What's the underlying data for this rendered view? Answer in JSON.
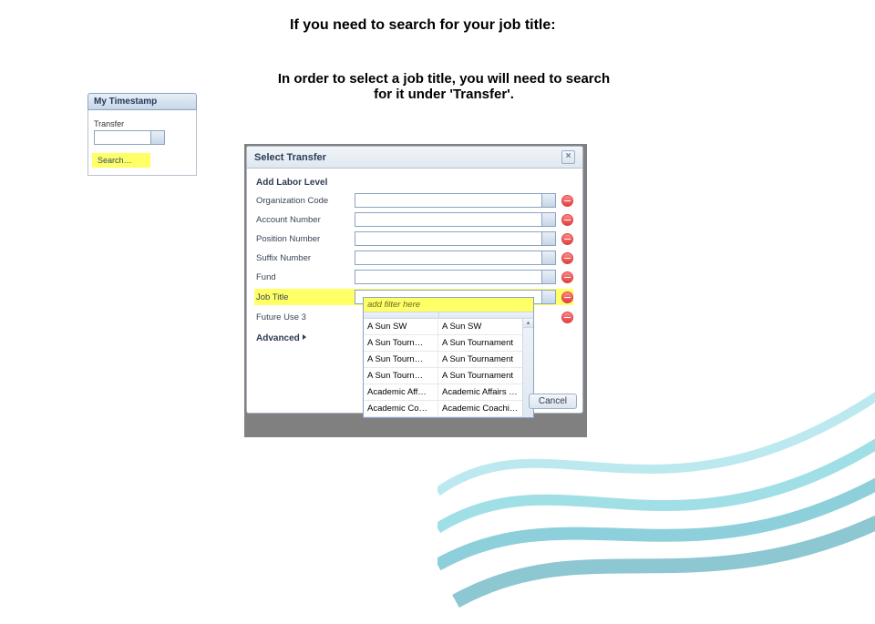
{
  "heading": "If you need to search for your job title:",
  "subhead": "In order to select a job title, you will need to search for it under 'Transfer'.",
  "left": {
    "tab": "My Timestamp",
    "transfer_label": "Transfer",
    "search_link": "Search…"
  },
  "modal": {
    "title": "Select Transfer",
    "close": "×",
    "section": "Add Labor Level",
    "advanced": "Advanced",
    "fields": [
      "Organization Code",
      "Account Number",
      "Position Number",
      "Suffix Number",
      "Fund",
      "Job Title",
      "Future Use 3"
    ],
    "filter_placeholder": "add filter here",
    "cancel": "Cancel"
  },
  "dropdown": {
    "rows": [
      {
        "c1": "A Sun SW",
        "c2": "A Sun SW"
      },
      {
        "c1": "A Sun Tourn…",
        "c2": "A Sun Tournament"
      },
      {
        "c1": "A Sun Tourn…",
        "c2": "A Sun Tournament"
      },
      {
        "c1": "A Sun Tourn…",
        "c2": "A Sun Tournament"
      },
      {
        "c1": "Academic Aff…",
        "c2": "Academic Affairs PT"
      },
      {
        "c1": "Academic Co…",
        "c2": "Academic Coaching"
      }
    ]
  }
}
